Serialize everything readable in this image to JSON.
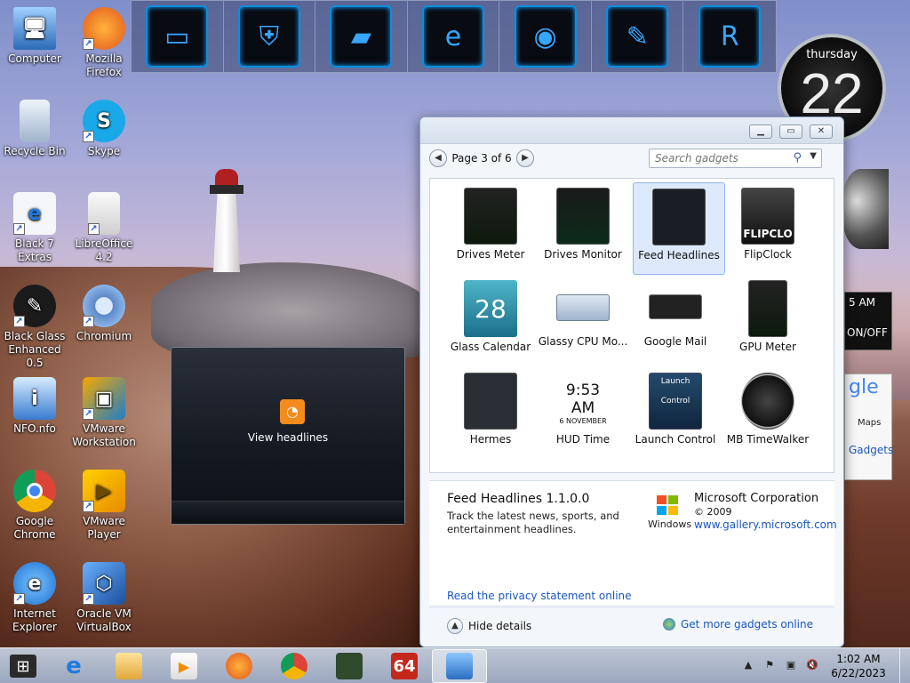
{
  "desktop": {
    "icons": [
      {
        "label": "Computer"
      },
      {
        "label": "Mozilla Firefox"
      },
      {
        "label": "Recycle Bin"
      },
      {
        "label": "Skype"
      },
      {
        "label": "Black 7 Extras"
      },
      {
        "label": "LibreOffice 4.2"
      },
      {
        "label": "Black Glass Enhanced 0.5"
      },
      {
        "label": "Chromium"
      },
      {
        "label": "NFO.nfo"
      },
      {
        "label": "VMware Workstation"
      },
      {
        "label": "Google Chrome"
      },
      {
        "label": "VMware Player"
      },
      {
        "label": "Internet Explorer"
      },
      {
        "label": "Oracle VM VirtualBox"
      }
    ]
  },
  "clock_gadget": {
    "day": "thursday",
    "number": "22"
  },
  "gadget_window": {
    "page_label": "Page 3 of 6",
    "search_placeholder": "Search gadgets",
    "gadgets": [
      {
        "name": "Drives Meter"
      },
      {
        "name": "Drives Monitor"
      },
      {
        "name": "Feed Headlines"
      },
      {
        "name": "FlipClock"
      },
      {
        "name": "Glass Calendar"
      },
      {
        "name": "Glassy CPU Mo..."
      },
      {
        "name": "Google Mail"
      },
      {
        "name": "GPU Meter"
      },
      {
        "name": "Hermes"
      },
      {
        "name": "HUD Time"
      },
      {
        "name": "Launch Control"
      },
      {
        "name": "MB TimeWalker"
      }
    ],
    "details": {
      "title": "Feed Headlines 1.1.0.0",
      "description": "Track the latest news, sports, and entertainment headlines.",
      "publisher": "Microsoft Corporation",
      "year": "© 2009",
      "url": "www.gallery.microsoft.com",
      "privacy": "Read the privacy statement online",
      "windows_label": "Windows"
    },
    "footer": {
      "hide_details": "Hide details",
      "more_gadgets": "Get more gadgets online"
    }
  },
  "feed_gadget": {
    "label": "View headlines"
  },
  "thumbs": {
    "calendar_day": "28",
    "hud_time": "9:53 AM",
    "hud_date": "6",
    "hud_month": "NOVEMBER",
    "launch": "Launch",
    "control": "Control",
    "flipclock": "FLIPCLO"
  },
  "right_fragments": {
    "slab_time": "5 AM",
    "slab_status": "ON/OFF",
    "google_text": "gle",
    "google_maps": "Maps",
    "google_gadgets": "Gadgets"
  },
  "taskbar": {
    "time": "1:02 AM",
    "date": "6/22/2023",
    "badge": "64"
  },
  "colors": {
    "link": "#1a56c0",
    "dock_accent": "#0a8fe0"
  }
}
